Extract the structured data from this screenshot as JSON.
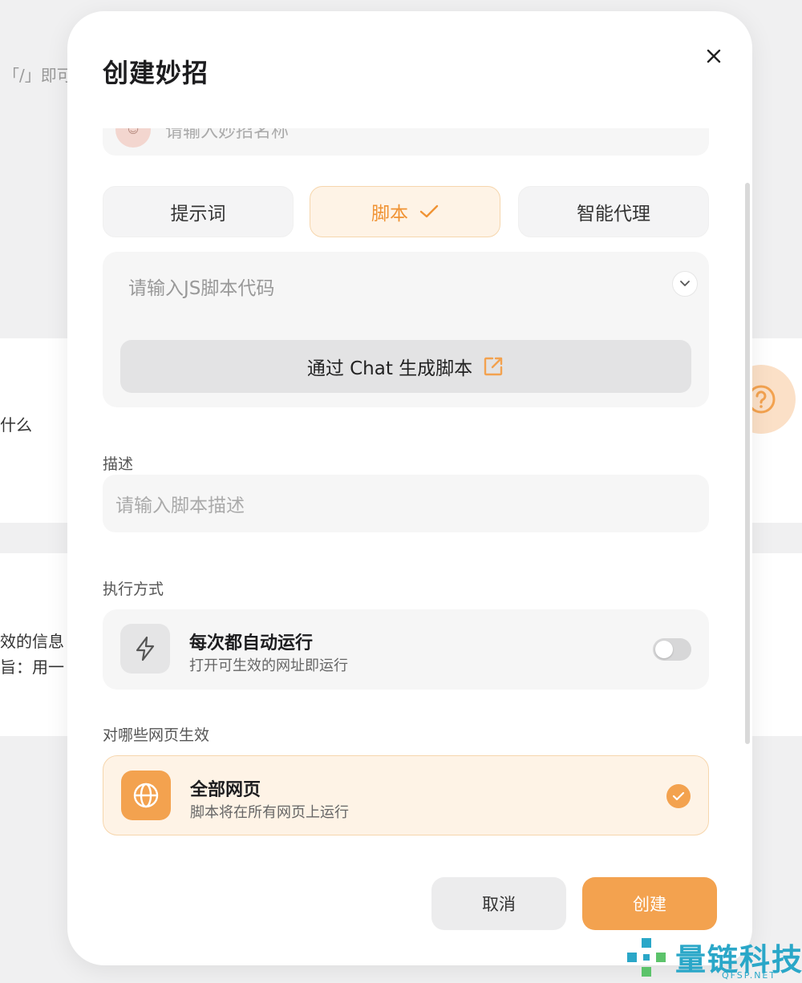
{
  "background": {
    "top_hint": "「/」即可",
    "card1_text": "什么",
    "card2_line1": "效的信息",
    "card2_line2": "旨：用一"
  },
  "modal": {
    "title": "创建妙招",
    "name_placeholder": "请输入妙招名称",
    "type_tabs": [
      {
        "label": "提示词",
        "active": false
      },
      {
        "label": "脚本",
        "active": true
      },
      {
        "label": "智能代理",
        "active": false
      }
    ],
    "code_placeholder": "请输入JS脚本代码",
    "generate_button": "通过 Chat 生成脚本",
    "description": {
      "label": "描述",
      "placeholder": "请输入脚本描述"
    },
    "execution": {
      "label": "执行方式",
      "title": "每次都自动运行",
      "subtitle": "打开可生效的网址即运行",
      "enabled": false
    },
    "scope": {
      "label": "对哪些网页生效",
      "title": "全部网页",
      "subtitle": "脚本将在所有网页上运行",
      "selected": true
    },
    "cancel_label": "取消",
    "create_label": "创建"
  },
  "watermark": {
    "name": "量链科技",
    "domain": "QFSP.NET"
  },
  "colors": {
    "accent": "#f3a24f",
    "accent_text": "#f09334",
    "accent_bg": "#fef3e6",
    "watermark": "#2aa7c8"
  }
}
